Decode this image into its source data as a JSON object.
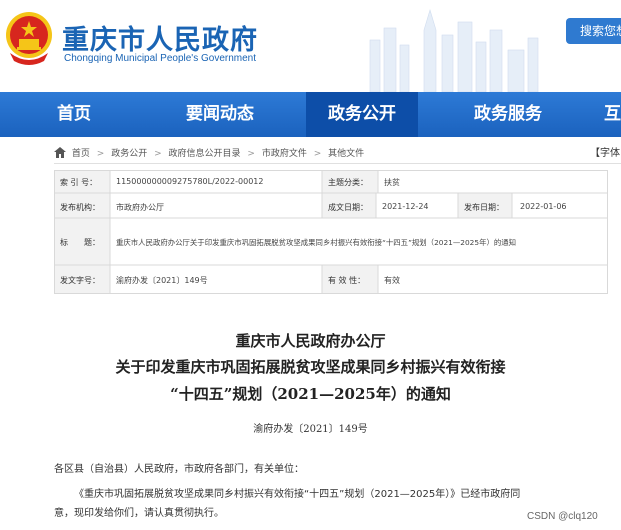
{
  "header": {
    "title": "重庆市人民政府",
    "subtitle": "Chongqing Municipal People's Government",
    "search_label": "搜索您想"
  },
  "nav": {
    "items": [
      {
        "label": "首页",
        "active": false
      },
      {
        "label": "要闻动态",
        "active": false
      },
      {
        "label": "政务公开",
        "active": true
      },
      {
        "label": "政务服务",
        "active": false
      },
      {
        "label": "互",
        "active": false
      }
    ]
  },
  "breadcrumb": {
    "items": [
      "首页",
      "政务公开",
      "政府信息公开目录",
      "市政府文件",
      "其他文件"
    ],
    "separator": ">",
    "font_label": "【字体"
  },
  "meta": {
    "index_label": "索 引 号：",
    "index_value": "115000000009275780L/2022-00012",
    "category_label": "主题分类：",
    "category_value": "扶贫",
    "issuer_label": "发布机构：",
    "issuer_value": "市政府办公厅",
    "created_label": "成文日期：",
    "created_value": "2021-12-24",
    "published_label": "发布日期：",
    "published_value": "2022-01-06",
    "title_label": "标　　题：",
    "title_value": "重庆市人民政府办公厅关于印发重庆市巩固拓展脱贫攻坚成果同乡村振兴有效衔接“十四五”规划（2021—2025年）的通知",
    "docno_label": "发文字号：",
    "docno_value": "渝府办发〔2021〕149号",
    "validity_label": "有 效 性：",
    "validity_value": "有效"
  },
  "article": {
    "title_line1": "重庆市人民政府办公厅",
    "title_line2": "关于印发重庆市巩固拓展脱贫攻坚成果同乡村振兴有效衔接",
    "title_line3": "“十四五”规划（2021—2025年）的通知",
    "doc_number": "渝府办发〔2021〕149号",
    "salutation": "各区县（自治县）人民政府，市政府各部门，有关单位：",
    "para1_line1": "《重庆市巩固拓展脱贫攻坚成果同乡村振兴有效衔接“十四五”规划（2021—2025年）》已经市政府同",
    "para1_line2": "意，现印发给你们，请认真贯彻执行。"
  },
  "watermark": "CSDN @clq120",
  "colors": {
    "brand_blue": "#1a64b4",
    "nav_blue": "#1b62be",
    "nav_active": "#0d4ea8",
    "emblem_red": "#d7261e",
    "emblem_gold": "#f5c518"
  }
}
